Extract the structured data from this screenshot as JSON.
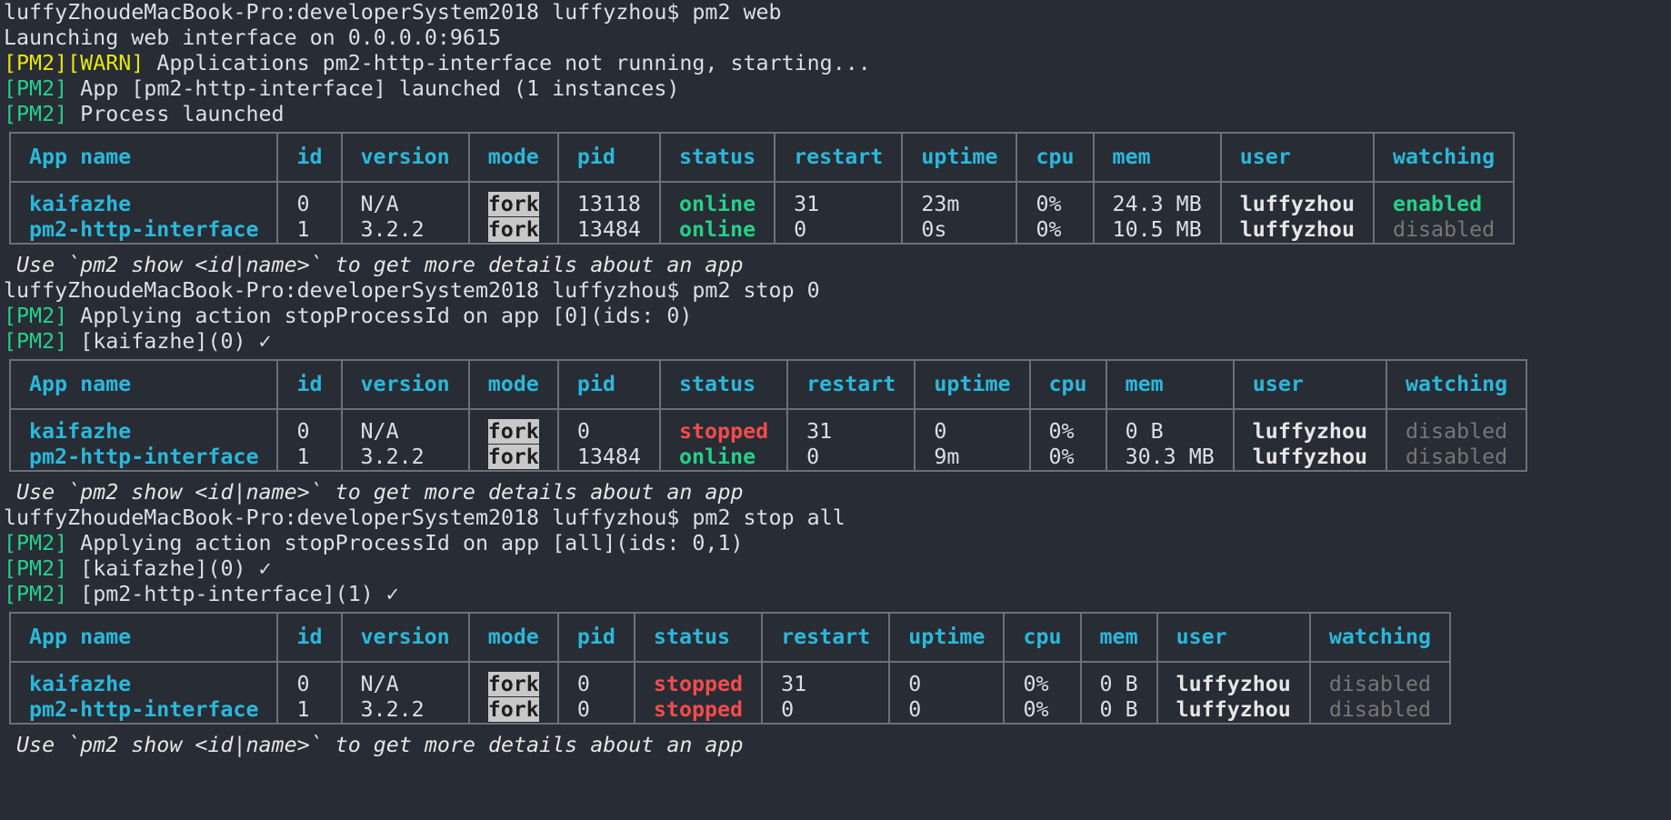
{
  "session": {
    "prompt": "luffyZhoudeMacBook-Pro:developerSystem2018 luffyzhou$ ",
    "cmd1": "pm2 web",
    "out1_launching": "Launching web interface on 0.0.0.0:9615",
    "tag_pm2": "[PM2]",
    "tag_warn": "[WARN]",
    "out1_warn": " Applications pm2-http-interface not running, starting...",
    "out1_app": " App [pm2-http-interface] launched (1 instances)",
    "out1_proc": " Process launched",
    "hint": " Use `pm2 show <id|name>` to get more details about an app",
    "cmd2": "pm2 stop 0",
    "out2_apply": " Applying action stopProcessId on app [0](ids: 0)",
    "out2_kai": " [kaifazhe](0) ✓",
    "cmd3": "pm2 stop all",
    "out3_apply": " Applying action stopProcessId on app [all](ids: 0,1)",
    "out3_kai": " [kaifazhe](0) ✓",
    "out3_http": " [pm2-http-interface](1) ✓",
    "hint_partial": " Use `pm2 show <id|name>` to get more details about an app"
  },
  "headers": [
    "App name",
    "id",
    "version",
    "mode",
    "pid",
    "status",
    "restart",
    "uptime",
    "cpu",
    "mem",
    "user",
    "watching"
  ],
  "tables": [
    {
      "rows": [
        {
          "name": "kaifazhe",
          "id": "0",
          "version": "N/A",
          "mode": "fork",
          "pid": "13118",
          "status": "online",
          "restart": "31",
          "uptime": "23m",
          "cpu": "0%",
          "mem": "24.3 MB",
          "user": "luffyzhou",
          "watching": "enabled"
        },
        {
          "name": "pm2-http-interface",
          "id": "1",
          "version": "3.2.2",
          "mode": "fork",
          "pid": "13484",
          "status": "online",
          "restart": "0",
          "uptime": "0s",
          "cpu": "0%",
          "mem": "10.5 MB",
          "user": "luffyzhou",
          "watching": "disabled"
        }
      ]
    },
    {
      "rows": [
        {
          "name": "kaifazhe",
          "id": "0",
          "version": "N/A",
          "mode": "fork",
          "pid": "0",
          "status": "stopped",
          "restart": "31",
          "uptime": "0",
          "cpu": "0%",
          "mem": "0 B",
          "user": "luffyzhou",
          "watching": "disabled"
        },
        {
          "name": "pm2-http-interface",
          "id": "1",
          "version": "3.2.2",
          "mode": "fork",
          "pid": "13484",
          "status": "online",
          "restart": "0",
          "uptime": "9m",
          "cpu": "0%",
          "mem": "30.3 MB",
          "user": "luffyzhou",
          "watching": "disabled"
        }
      ]
    },
    {
      "rows": [
        {
          "name": "kaifazhe",
          "id": "0",
          "version": "N/A",
          "mode": "fork",
          "pid": "0",
          "status": "stopped",
          "restart": "31",
          "uptime": "0",
          "cpu": "0%",
          "mem": "0 B",
          "user": "luffyzhou",
          "watching": "disabled"
        },
        {
          "name": "pm2-http-interface",
          "id": "1",
          "version": "3.2.2",
          "mode": "fork",
          "pid": "0",
          "status": "stopped",
          "restart": "0",
          "uptime": "0",
          "cpu": "0%",
          "mem": "0 B",
          "user": "luffyzhou",
          "watching": "disabled"
        }
      ]
    }
  ],
  "colors": {
    "background": "#282c34",
    "cyan": "#29b8db",
    "green": "#23d18b",
    "red": "#f14c4c",
    "yellow": "#e5e510",
    "gray": "#767676"
  }
}
